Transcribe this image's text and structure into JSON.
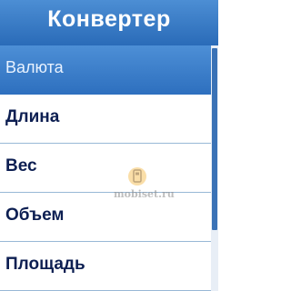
{
  "header": {
    "title": "Конвертер"
  },
  "menu": {
    "items": [
      {
        "label": "Валюта",
        "selected": true
      },
      {
        "label": "Длина",
        "selected": false
      },
      {
        "label": "Вес",
        "selected": false
      },
      {
        "label": "Объем",
        "selected": false
      },
      {
        "label": "Площадь",
        "selected": false
      }
    ]
  },
  "watermark": {
    "text": "mobiset.ru",
    "icon": "mobiset-logo"
  },
  "colors": {
    "header_bg": "#2a6bb8",
    "selection_bg": "#3f80cb",
    "item_text": "#0d1f52",
    "divider": "#98b8d6"
  }
}
